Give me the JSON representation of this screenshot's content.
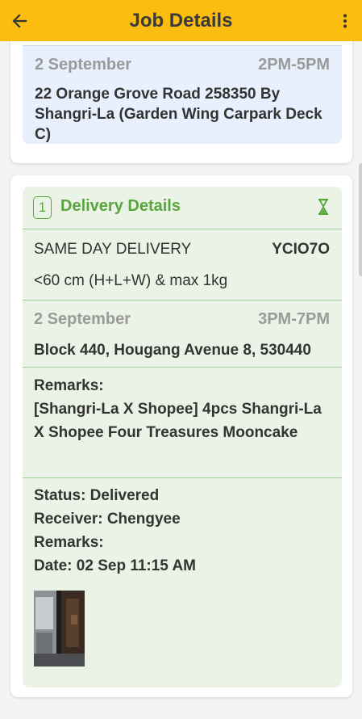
{
  "appbar": {
    "title": "Job Details",
    "back_icon": "arrow-left-icon",
    "menu_icon": "more-vertical-icon",
    "color": "#fbbd0f"
  },
  "pickup": {
    "date": "2 September",
    "time": "2PM-5PM",
    "address": "22 Orange Grove Road 258350 By Shangri-La (Garden Wing Carpark Deck C)"
  },
  "delivery": {
    "index": "1",
    "title": "Delivery Details",
    "status_icon": "hourglass-icon",
    "service": "SAME DAY DELIVERY",
    "code": "YCIO7O",
    "size": "<60 cm (H+L+W) & max 1kg",
    "date": "2 September",
    "time": "3PM-7PM",
    "address": "Block 440, Hougang Avenue 8, 530440",
    "remarks_label": "Remarks:",
    "remarks": "[Shangri-La X Shopee] 4pcs Shangri-La X Shopee Four Treasures Mooncake",
    "status": "Status: Delivered",
    "receiver": "Receiver: Chengyee",
    "pod_remarks": "Remarks:",
    "pod_date": "Date: 02 Sep 11:15 AM",
    "accent_color": "#5aa63e"
  }
}
